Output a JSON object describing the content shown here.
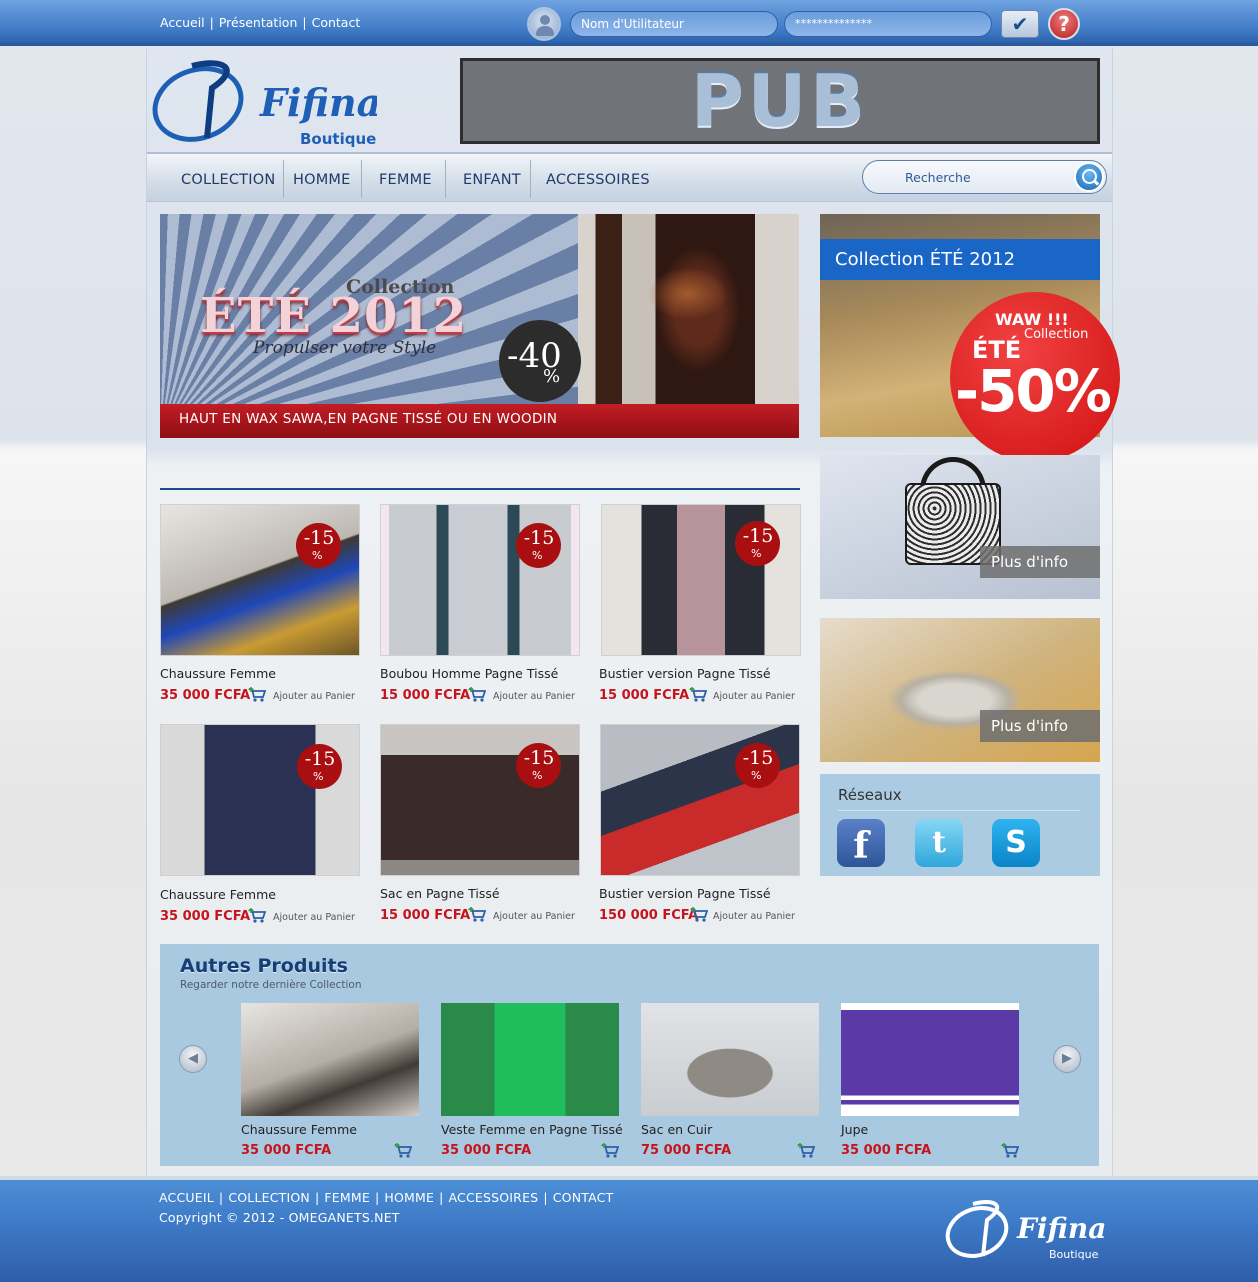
{
  "top_nav": {
    "links": [
      "Accueil",
      "Présentation",
      "Contact"
    ]
  },
  "login": {
    "username_placeholder": "Nom d'Utilitateur",
    "password_placeholder": "**************"
  },
  "header": {
    "brand": "Fifina",
    "brand_sub": "Boutique",
    "pub_text": "PUB"
  },
  "main_nav": {
    "items": [
      "COLLECTION",
      "HOMME",
      "FEMME",
      "ENFANT",
      "ACCESSOIRES"
    ]
  },
  "search": {
    "placeholder": "Recherche"
  },
  "hero": {
    "collection_label": "Collection",
    "title": "ÉTÉ 2012",
    "subtitle": "Propulser votre Style",
    "discount_value": "-40",
    "discount_unit": "%",
    "caption": "HAUT EN WAX SAWA,EN PAGNE TISSÉ OU EN WOODIN"
  },
  "promo": {
    "heading": "Collection ÉTÉ 2012",
    "waw": "WAW !!!",
    "collection": "Collection",
    "ete": "ÉTÉ",
    "discount": "-50%"
  },
  "side_tiles": [
    {
      "label": "Plus d'info"
    },
    {
      "label": "Plus d'info"
    }
  ],
  "reseaux": {
    "title": "Réseaux",
    "networks": [
      "facebook",
      "twitter",
      "skype"
    ]
  },
  "products": {
    "badge_value": "-15",
    "badge_unit": "%",
    "add_label": "Ajouter au Panier",
    "items": [
      {
        "name": "Chaussure Femme",
        "price": "35 000 FCFA"
      },
      {
        "name": "Boubou Homme Pagne Tissé",
        "price": "15 000 FCFA"
      },
      {
        "name": "Bustier version Pagne Tissé",
        "price": "15 000 FCFA"
      },
      {
        "name": "Chaussure Femme",
        "price": "35 000 FCFA"
      },
      {
        "name": "Sac en Pagne Tissé",
        "price": "15 000 FCFA"
      },
      {
        "name": "Bustier version Pagne Tissé",
        "price": "150 000 FCFA"
      }
    ]
  },
  "autres": {
    "title": "Autres Produits",
    "subtitle": "Regarder notre dernière Collection",
    "items": [
      {
        "name": "Chaussure Femme",
        "price": "35 000 FCFA"
      },
      {
        "name": "Veste Femme en Pagne Tissé",
        "price": "35 000 FCFA"
      },
      {
        "name": "Sac en Cuir",
        "price": "75 000 FCFA"
      },
      {
        "name": "Jupe",
        "price": "35 000 FCFA"
      }
    ]
  },
  "footer": {
    "links": [
      "ACCUEIL",
      "COLLECTION",
      "FEMME",
      "HOMME",
      "ACCESSOIRES",
      "CONTACT"
    ],
    "copyright": "Copyright © 2012 - OMEGANETS.NET",
    "brand": "Fifina",
    "brand_sub": "Boutique"
  },
  "colors": {
    "accent_blue": "#1a66c7",
    "price_red": "#c5141c",
    "badge_red": "#a90f10"
  }
}
